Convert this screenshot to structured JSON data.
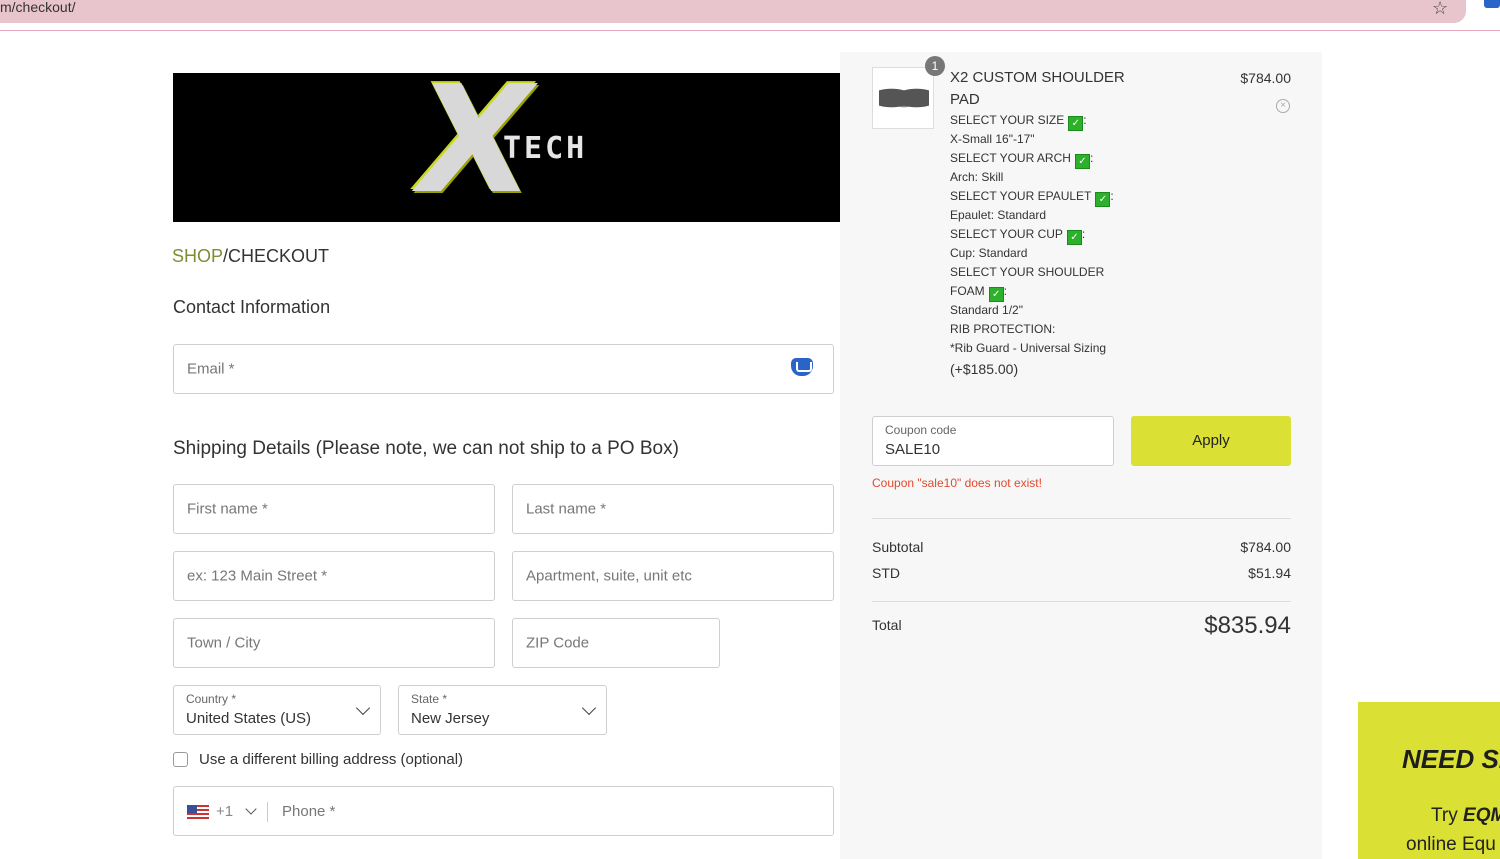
{
  "browser": {
    "url": "m/checkout/"
  },
  "logo": {
    "mark": "X",
    "text": "TECH"
  },
  "breadcrumb": {
    "shop": "SHOP",
    "separator": "/",
    "current": "CHECKOUT"
  },
  "contact": {
    "heading": "Contact Information",
    "email_placeholder": "Email *"
  },
  "shipping": {
    "heading": "Shipping Details (Please note, we can not ship to a PO Box)",
    "first_name": "First name *",
    "last_name": "Last name *",
    "street": "ex: 123 Main Street *",
    "apartment": "Apartment, suite, unit etc",
    "city": "Town / City",
    "zip": "ZIP Code",
    "country_label": "Country *",
    "country_value": "United States (US)",
    "state_label": "State *",
    "state_value": "New Jersey",
    "billing_checkbox": "Use a different billing address (optional)",
    "phone_code": "+1",
    "phone_placeholder": "Phone *"
  },
  "cart": {
    "item": {
      "quantity": "1",
      "name": "X2 CUSTOM SHOULDER PAD",
      "price": "$784.00",
      "remove_icon": "close-circle-icon",
      "options": [
        {
          "label": "SELECT YOUR SIZE",
          "check": true,
          "value": "X-Small 16\"-17\""
        },
        {
          "label": "SELECT YOUR ARCH",
          "check": true,
          "value": "Arch: Skill"
        },
        {
          "label": "SELECT YOUR EPAULET",
          "check": true,
          "value": "Epaulet: Standard"
        },
        {
          "label": "SELECT YOUR CUP",
          "check": true,
          "value": "Cup: Standard"
        },
        {
          "label_line1": "SELECT YOUR SHOULDER",
          "label_line2": "FOAM",
          "check": true,
          "value": "Standard 1/2\""
        },
        {
          "label": "RIB PROTECTION:",
          "value": "*Rib Guard - Universal Sizing"
        }
      ],
      "addon_price": "(+$185.00)"
    },
    "coupon": {
      "label": "Coupon code",
      "value": "SALE10",
      "button": "Apply",
      "error": "Coupon \"sale10\" does not exist!"
    },
    "subtotal_label": "Subtotal",
    "subtotal_value": "$784.00",
    "shipping_label": "STD",
    "shipping_value": "$51.94",
    "total_label": "Total",
    "total_value": "$835.94"
  },
  "promo": {
    "heading": "NEED SI",
    "line1_prefix": "Try ",
    "line1_brand": "EQM",
    "line2": "online Equ"
  },
  "colors": {
    "accent": "#dbe034",
    "shop_link": "#7a8f33",
    "error": "#e04b2f",
    "url_bar": "#e8c4cd"
  }
}
